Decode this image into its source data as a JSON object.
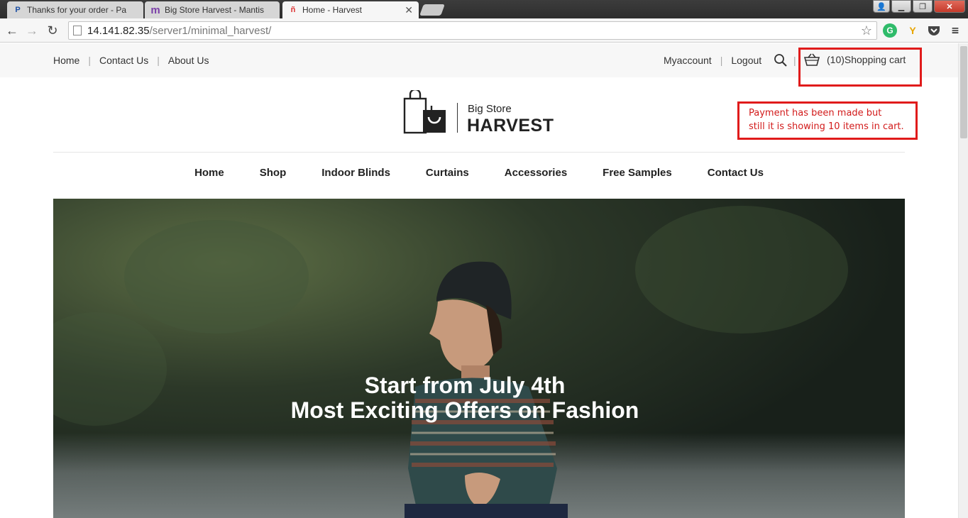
{
  "browser": {
    "tabs": [
      {
        "title": "Thanks for your order - Pa",
        "favicon": "paypal-icon"
      },
      {
        "title": "Big Store Harvest - Mantis",
        "favicon": "mantis-icon"
      },
      {
        "title": "Home - Harvest",
        "favicon": "harvest-icon",
        "active": true
      }
    ],
    "url_host": "14.141.82.35",
    "url_path": "/server1/minimal_harvest/"
  },
  "topbar": {
    "left_links": [
      "Home",
      "Contact Us",
      "About Us"
    ],
    "right_links": [
      "Myaccount",
      "Logout"
    ],
    "cart_label": "(10)Shopping cart"
  },
  "logo": {
    "small": "Big Store",
    "big": "HARVEST"
  },
  "main_nav": [
    "Home",
    "Shop",
    "Indoor Blinds",
    "Curtains",
    "Accessories",
    "Free Samples",
    "Contact Us"
  ],
  "hero": {
    "line1": "Start from July 4th",
    "line2": "Most Exciting Offers on Fashion"
  },
  "annotation": {
    "line1": "Payment has been made but",
    "line2": "still it is showing 10 items in cart."
  },
  "colors": {
    "annotation_red": "#e01b1b",
    "text_dark": "#222222"
  }
}
